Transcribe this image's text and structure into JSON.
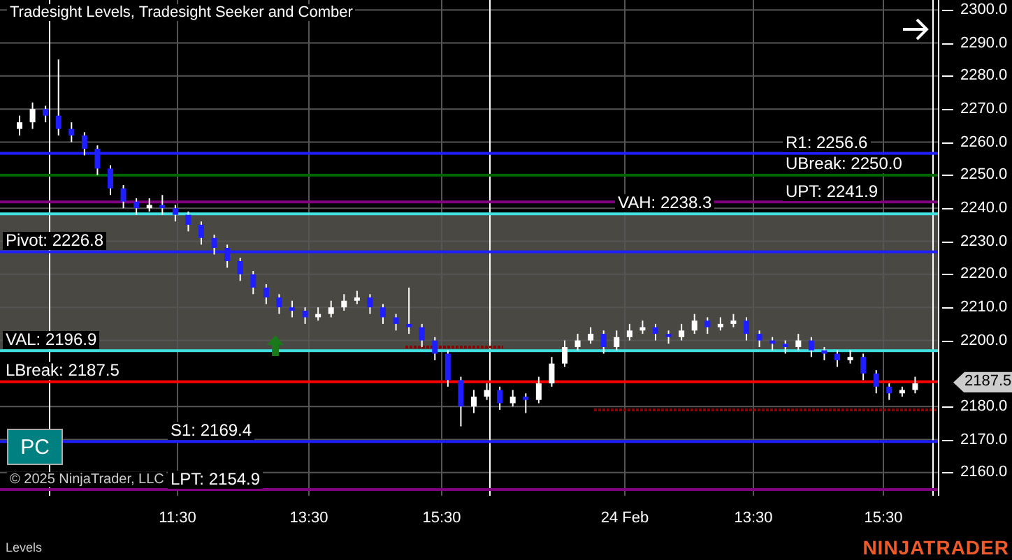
{
  "chart": {
    "title": "Tradesight Levels, Tradesight Seeker and Comber",
    "levels": [
      {
        "label": "R1: 2256.6",
        "color": "#1e1eff"
      },
      {
        "label": "UBreak: 2250.0",
        "color": "#006400"
      },
      {
        "label": "UPT: 2241.9",
        "color": "#800080"
      },
      {
        "label": "VAH: 2238.3",
        "color": "#40e0e0"
      },
      {
        "label": "Pivot: 2226.8",
        "color": "#1e1eff"
      },
      {
        "label": "VAL: 2196.9",
        "color": "#40e0e0"
      },
      {
        "label": "LBreak: 2187.5",
        "color": "#ff0000"
      },
      {
        "label": "S1: 2169.4",
        "color": "#1e1eff"
      },
      {
        "label": "LPT: 2154.9",
        "color": "#800080"
      }
    ],
    "chart_data": {
      "type": "candlestick",
      "ylim": [
        2153,
        2303
      ],
      "grid": true,
      "yticks": [
        {
          "value": 2300,
          "label": "2300.0"
        },
        {
          "value": 2290,
          "label": "2290.0"
        },
        {
          "value": 2280,
          "label": "2280.0"
        },
        {
          "value": 2270,
          "label": "2270.0"
        },
        {
          "value": 2260,
          "label": "2260.0"
        },
        {
          "value": 2250,
          "label": "2250.0"
        },
        {
          "value": 2240,
          "label": "2240.0"
        },
        {
          "value": 2230,
          "label": "2230.0"
        },
        {
          "value": 2220,
          "label": "2220.0"
        },
        {
          "value": 2210,
          "label": "2210.0"
        },
        {
          "value": 2200,
          "label": "2200.0"
        },
        {
          "value": 2180,
          "label": "2180.0"
        },
        {
          "value": 2170,
          "label": "2170.0"
        },
        {
          "value": 2160,
          "label": "2160.0"
        }
      ],
      "categories": [
        null,
        null,
        null,
        null,
        null,
        null,
        null,
        null,
        null,
        null,
        null,
        null,
        null,
        null,
        null,
        null,
        null,
        null,
        null,
        null,
        null,
        null,
        null,
        null,
        null,
        null,
        null,
        null,
        null,
        null,
        null,
        null,
        null,
        null,
        null,
        null,
        null,
        null,
        null,
        null,
        null,
        null,
        null,
        null,
        null,
        null,
        null,
        null,
        null,
        null,
        null,
        null,
        null,
        null,
        null,
        null,
        null,
        null,
        null,
        null,
        null,
        null,
        null,
        null,
        null,
        null,
        null,
        null,
        null,
        null
      ],
      "ohlc": [
        [
          2264,
          2268,
          2262,
          2266
        ],
        [
          2266,
          2272,
          2264,
          2270
        ],
        [
          2270,
          2271,
          2266,
          2268
        ],
        [
          2268,
          2285,
          2262,
          2264
        ],
        [
          2264,
          2266,
          2260,
          2262
        ],
        [
          2262,
          2263,
          2256,
          2258
        ],
        [
          2258,
          2259,
          2250,
          2252
        ],
        [
          2252,
          2253,
          2244,
          2246
        ],
        [
          2246,
          2247,
          2240,
          2242
        ],
        [
          2242,
          2243,
          2238,
          2240
        ],
        [
          2240,
          2243,
          2239,
          2241
        ],
        [
          2241,
          2244,
          2238,
          2240
        ],
        [
          2240,
          2241,
          2236,
          2238
        ],
        [
          2238,
          2239,
          2233,
          2235
        ],
        [
          2235,
          2236,
          2229,
          2231
        ],
        [
          2231,
          2232,
          2226,
          2228
        ],
        [
          2228,
          2229,
          2222,
          2224
        ],
        [
          2224,
          2225,
          2218,
          2220
        ],
        [
          2220,
          2221,
          2214,
          2216
        ],
        [
          2216,
          2217,
          2211,
          2213
        ],
        [
          2213,
          2214,
          2208,
          2210
        ],
        [
          2210,
          2212,
          2207,
          2209
        ],
        [
          2209,
          2210,
          2205,
          2207
        ],
        [
          2207,
          2210,
          2206,
          2208
        ],
        [
          2208,
          2212,
          2207,
          2210
        ],
        [
          2210,
          2214,
          2209,
          2212
        ],
        [
          2212,
          2215,
          2211,
          2213
        ],
        [
          2213,
          2214,
          2208,
          2210
        ],
        [
          2210,
          2211,
          2205,
          2207
        ],
        [
          2207,
          2208,
          2203,
          2205
        ],
        [
          2205,
          2216,
          2202,
          2204
        ],
        [
          2204,
          2205,
          2198,
          2200
        ],
        [
          2200,
          2201,
          2194,
          2196
        ],
        [
          2196,
          2197,
          2186,
          2188
        ],
        [
          2188,
          2189,
          2174,
          2180
        ],
        [
          2180,
          2185,
          2178,
          2183
        ],
        [
          2183,
          2187,
          2182,
          2185
        ],
        [
          2185,
          2186,
          2179,
          2181
        ],
        [
          2181,
          2185,
          2180,
          2183
        ],
        [
          2183,
          2184,
          2178,
          2182
        ],
        [
          2182,
          2189,
          2181,
          2187
        ],
        [
          2187,
          2195,
          2186,
          2193
        ],
        [
          2193,
          2200,
          2192,
          2198
        ],
        [
          2198,
          2202,
          2197,
          2200
        ],
        [
          2200,
          2204,
          2199,
          2202
        ],
        [
          2202,
          2203,
          2196,
          2198
        ],
        [
          2198,
          2203,
          2197,
          2201
        ],
        [
          2201,
          2205,
          2200,
          2203
        ],
        [
          2203,
          2206,
          2202,
          2204
        ],
        [
          2204,
          2205,
          2200,
          2202
        ],
        [
          2202,
          2203,
          2199,
          2201
        ],
        [
          2201,
          2205,
          2200,
          2203
        ],
        [
          2203,
          2208,
          2202,
          2206
        ],
        [
          2206,
          2207,
          2202,
          2204
        ],
        [
          2204,
          2207,
          2203,
          2205
        ],
        [
          2205,
          2208,
          2204,
          2206
        ],
        [
          2206,
          2207,
          2200,
          2202
        ],
        [
          2202,
          2203,
          2198,
          2200
        ],
        [
          2200,
          2201,
          2197,
          2199
        ],
        [
          2199,
          2200,
          2196,
          2198
        ],
        [
          2198,
          2202,
          2197,
          2200
        ],
        [
          2200,
          2201,
          2195,
          2197
        ],
        [
          2197,
          2198,
          2194,
          2196
        ],
        [
          2196,
          2197,
          2192,
          2194
        ],
        [
          2194,
          2197,
          2193,
          2195
        ],
        [
          2195,
          2196,
          2188,
          2190
        ],
        [
          2190,
          2191,
          2184,
          2186
        ],
        [
          2186,
          2187,
          2182,
          2184
        ],
        [
          2184,
          2186,
          2183,
          2185
        ],
        [
          2185,
          2189,
          2184,
          2187
        ]
      ]
    },
    "mode_button": "PC",
    "copyright": "© 2025 NinjaTrader, LLC"
  },
  "price_axis": {
    "last_price": "2187.5"
  },
  "time_axis": [
    "11:30",
    "13:30",
    "15:30",
    "24 Feb",
    "13:30",
    "15:30"
  ],
  "status_bar": {
    "text": "Levels",
    "logo": "NINJATRADER"
  }
}
